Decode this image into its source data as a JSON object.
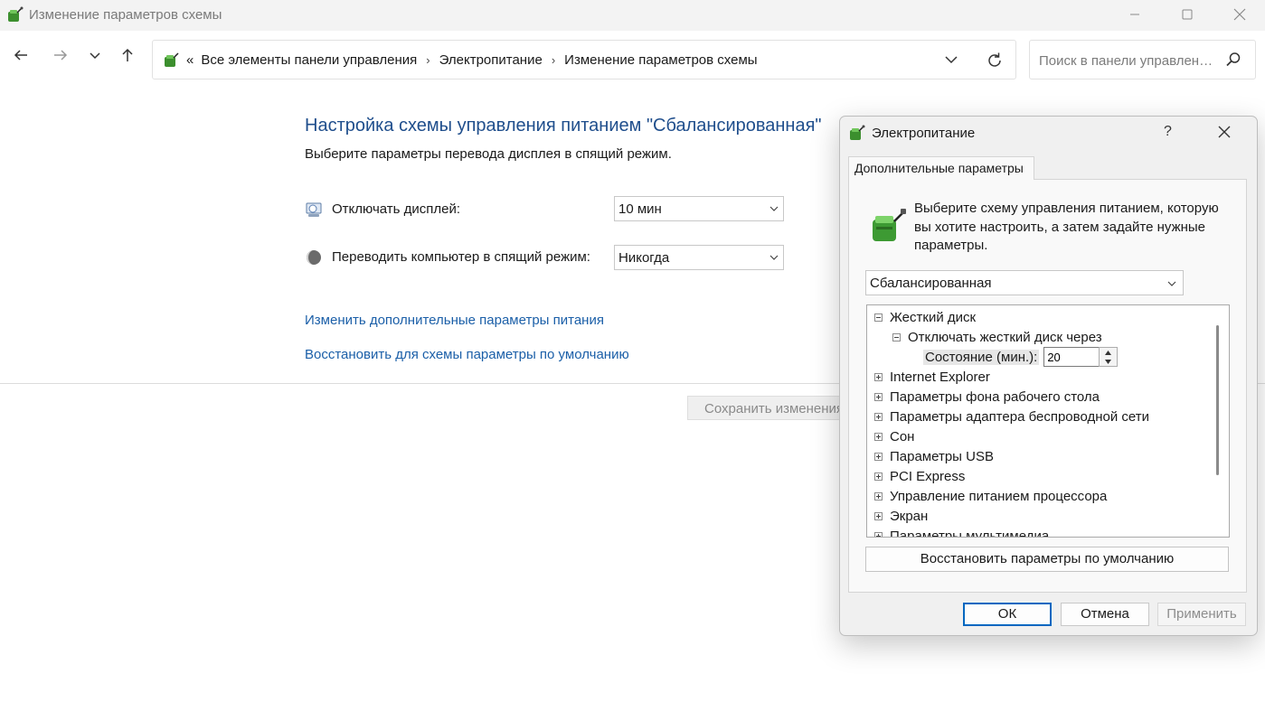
{
  "window": {
    "title": "Изменение параметров схемы",
    "controls": {
      "minimize": "minimize-icon",
      "maximize": "maximize-icon",
      "close": "close-icon"
    }
  },
  "nav": {
    "breadcrumb_overflow": "«",
    "breadcrumbs": [
      "Все элементы панели управления",
      "Электропитание",
      "Изменение параметров схемы"
    ],
    "search_placeholder": "Поиск в панели управлен…"
  },
  "main": {
    "title": "Настройка схемы управления питанием \"Сбалансированная\"",
    "subtitle": "Выберите параметры перевода дисплея в спящий режим.",
    "display_off": {
      "label": "Отключать дисплей:",
      "value": "10 мин"
    },
    "sleep": {
      "label": "Переводить компьютер в спящий режим:",
      "value": "Никогда"
    },
    "link_advanced": "Изменить дополнительные параметры питания",
    "link_restore": "Восстановить для схемы параметры по умолчанию",
    "save_label": "Сохранить изменения"
  },
  "dialog": {
    "title": "Электропитание",
    "help": "?",
    "tab": "Дополнительные параметры",
    "description": "Выберите схему управления питанием, которую вы хотите настроить, а затем задайте нужные параметры.",
    "plan": "Сбалансированная",
    "tree": {
      "hard_disk": "Жесткий диск",
      "turn_off_disk": "Отключать жесткий диск через",
      "state_label": "Состояние (мин.):",
      "state_value": "20",
      "items": [
        "Internet Explorer",
        "Параметры фона рабочего стола",
        "Параметры адаптера беспроводной сети",
        "Сон",
        "Параметры USB",
        "PCI Express",
        "Управление питанием процессора",
        "Экран",
        "Параметры мультимедиа"
      ]
    },
    "restore_label": "Восстановить параметры по умолчанию",
    "ok_label": "ОК",
    "cancel_label": "Отмена",
    "apply_label": "Применить"
  },
  "colors": {
    "link": "#1b5fa8",
    "title": "#1f4e8c",
    "accent": "#0067c0"
  }
}
